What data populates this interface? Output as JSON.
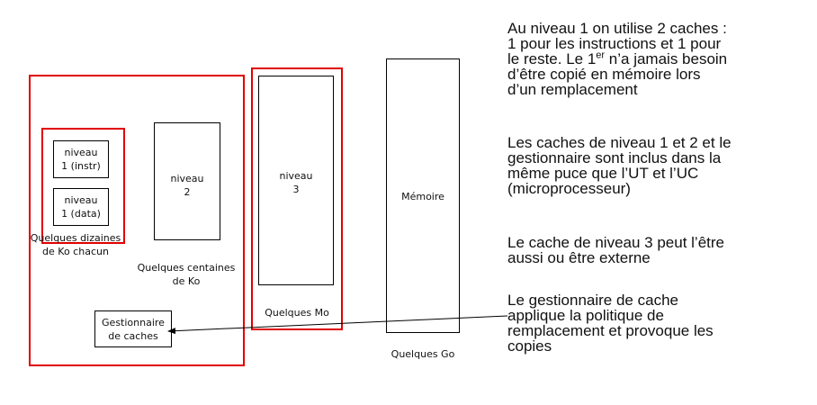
{
  "diagram": {
    "boxes": {
      "l1_instr": "niveau\n1 (instr)",
      "l1_data": "niveau\n1 (data)",
      "l2": "niveau\n2",
      "l3": "niveau\n3",
      "memory": "Mémoire",
      "manager": "Gestionnaire\nde caches"
    },
    "labels": {
      "l1_size": "Quelques dizaines\nde Ko chacun",
      "l2_size": "Quelques centaines\nde Ko",
      "l3_size": "Quelques Mo",
      "memory_size": "Quelques Go"
    },
    "colors": {
      "highlight": "#e10000",
      "outline": "#000000"
    }
  },
  "notes": {
    "note1_pre": "Au niveau 1 on utilise 2 caches :\n1 pour les instructions et 1 pour\nle reste. Le 1",
    "note1_sup": "er",
    "note1_post": " n’a jamais besoin\nd’être copié en mémoire lors\nd’un remplacement",
    "note2": "Les caches de niveau 1 et 2 et le\ngestionnaire sont inclus dans la\nmême puce que l’UT et l’UC\n(microprocesseur)",
    "note3": "Le cache de niveau 3 peut l’être\naussi ou être externe",
    "note4": "Le gestionnaire de cache\napplique la politique de\nremplacement et provoque les\ncopies"
  }
}
